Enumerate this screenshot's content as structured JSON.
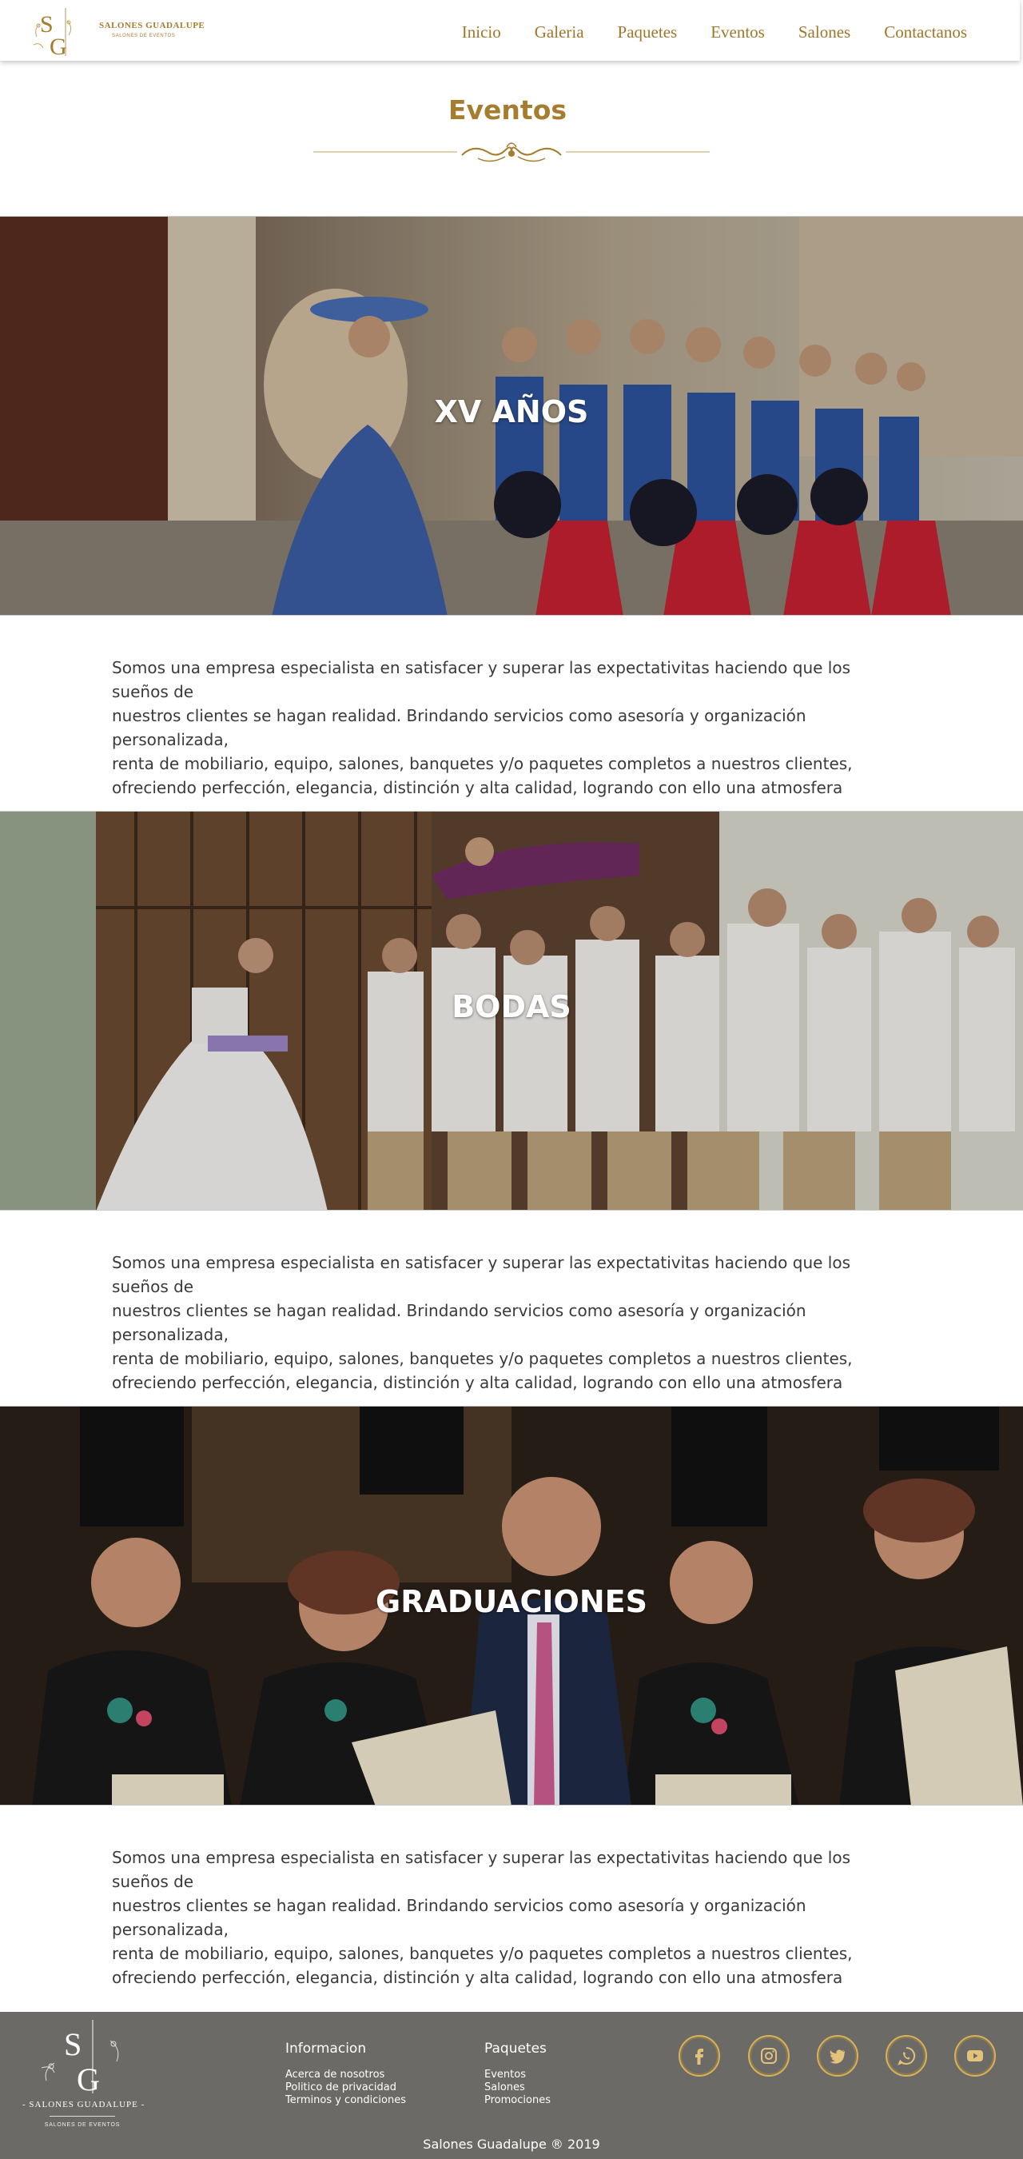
{
  "header": {
    "logo_initials": "SG",
    "logo_name": "SALONES GUADALUPE",
    "logo_tagline": "SALONES DE EVENTOS",
    "nav": [
      {
        "label": "Inicio"
      },
      {
        "label": "Galeria"
      },
      {
        "label": "Paquetes"
      },
      {
        "label": "Eventos"
      },
      {
        "label": "Salones"
      },
      {
        "label": "Contactanos"
      }
    ]
  },
  "page": {
    "title": "Eventos"
  },
  "events": [
    {
      "title": "XV AÑOS",
      "description": "Somos una empresa especialista en satisfacer y superar las expectativitas haciendo que los  sueños de\nnuestros clientes se hagan  realidad. Brindando servicios como asesoría y organización personalizada,\nrenta de mobiliario, equipo, salones, banquetes y/o  paquetes completos a nuestros clientes,\nofreciendo perfección, elegancia, distinción y alta calidad, logrando  con ello  una  atmosfera"
    },
    {
      "title": "BODAS",
      "description": "Somos una empresa especialista en satisfacer y superar las expectativitas haciendo que los  sueños de\nnuestros clientes se hagan  realidad. Brindando servicios como asesoría y organización personalizada,\nrenta de mobiliario, equipo, salones, banquetes y/o  paquetes completos a nuestros clientes,\nofreciendo perfección, elegancia, distinción y alta calidad, logrando  con ello  una  atmosfera"
    },
    {
      "title": "GRADUACIONES",
      "description": "Somos una empresa especialista en satisfacer y superar las expectativitas haciendo que los  sueños de\nnuestros clientes se hagan  realidad. Brindando servicios como asesoría y organización personalizada,\nrenta de mobiliario, equipo, salones, banquetes y/o  paquetes completos a nuestros clientes,\nofreciendo perfección, elegancia, distinción y alta calidad, logrando  con ello  una  atmosfera"
    }
  ],
  "footer": {
    "logo_name": "- SALONES GUADALUPE -",
    "logo_tagline": "SALONES DE EVENTOS",
    "info_title": "Informacion",
    "info_links": [
      "Acerca de nosotros",
      "Politico de privacidad",
      "Terminos y condiciones"
    ],
    "packages_title": "Paquetes",
    "packages_links": [
      "Eventos",
      "Salones",
      "Promociones"
    ],
    "social_icons": [
      "facebook-icon",
      "instagram-icon",
      "twitter-icon",
      "whatsapp-icon",
      "youtube-icon"
    ],
    "copyright": "Salones Guadalupe ® 2019"
  },
  "colors": {
    "gold": "#a67c2e",
    "footer_bg": "#6b6a66",
    "text": "#3a3a3a"
  }
}
